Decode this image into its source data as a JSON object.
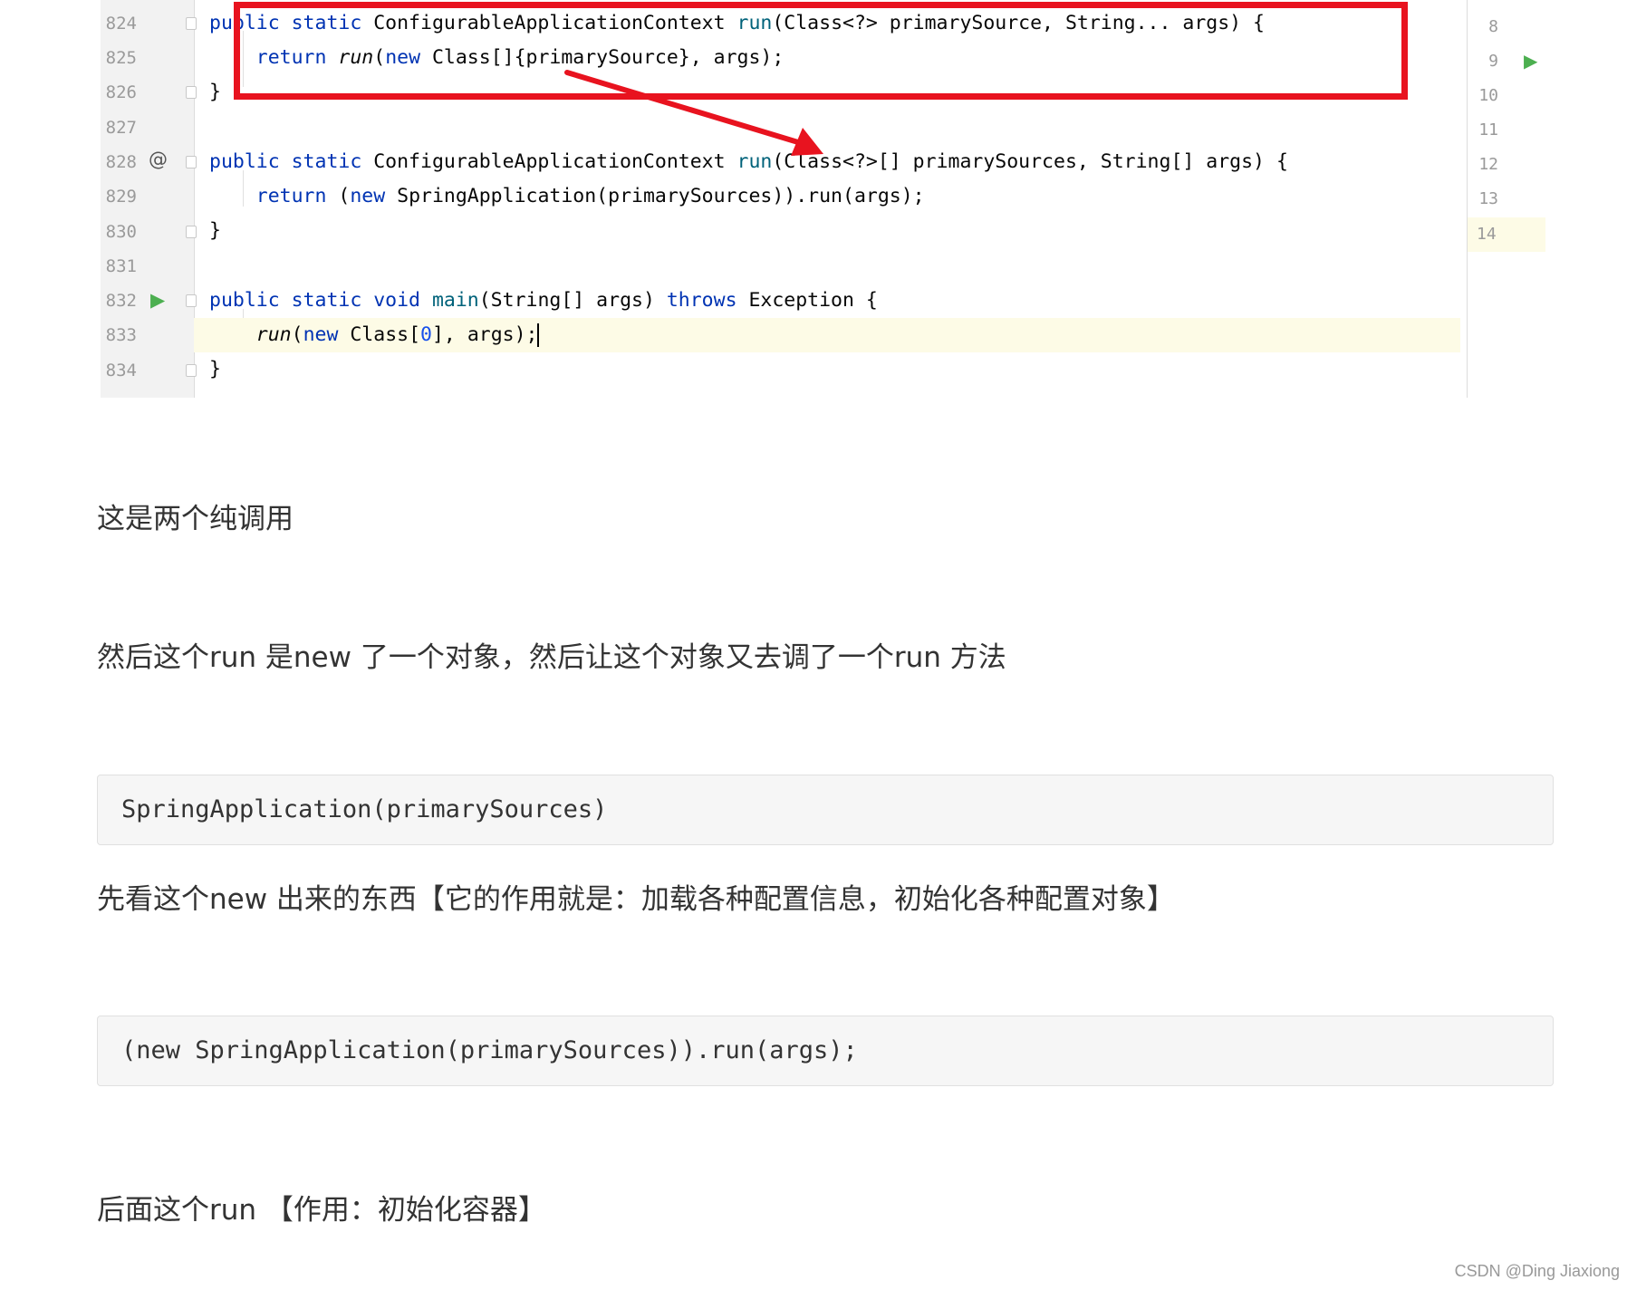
{
  "ide": {
    "line_numbers": [
      "824",
      "825",
      "826",
      "827",
      "828",
      "829",
      "830",
      "831",
      "832",
      "833",
      "834"
    ],
    "minimap_numbers": [
      "8",
      "9",
      "10",
      "11",
      "12",
      "13",
      "14"
    ],
    "annotation_symbol": "@",
    "code": {
      "l824_a": "public static ",
      "l824_b": "ConfigurableApplicationContext ",
      "l824_c": "run",
      "l824_d": "(Class<?> primarySource, String... args) {",
      "l825_a": "    return ",
      "l825_b": "run",
      "l825_c": "(",
      "l825_d": "new ",
      "l825_e": "Class[]{primarySource}, args);",
      "l826": "}",
      "l828_a": "public static ",
      "l828_b": "ConfigurableApplicationContext ",
      "l828_c": "run",
      "l828_d": "(Class<?>[] primarySources, String[] args) {",
      "l829_a": "    return ",
      "l829_b": "(",
      "l829_c": "new ",
      "l829_d": "SpringApplication(primarySources)).run(args);",
      "l830": "}",
      "l832_a": "public static void ",
      "l832_b": "main",
      "l832_c": "(String[] args) ",
      "l832_d": "throws ",
      "l832_e": "Exception {",
      "l833_a": "    ",
      "l833_b": "run",
      "l833_c": "(",
      "l833_d": "new ",
      "l833_e": "Class[",
      "l833_f": "0",
      "l833_g": "], args);",
      "l834": "}"
    },
    "colors": {
      "highlight_box": "#e8131f",
      "keyword": "#0033b3",
      "method": "#00627a",
      "current_line": "#fdfbe6"
    }
  },
  "article": {
    "p1": "这是两个纯调用",
    "p2": "然后这个run 是new 了一个对象，然后让这个对象又去调了一个run 方法",
    "code1": "SpringApplication(primarySources)",
    "p3": "先看这个new 出来的东西【它的作用就是：加载各种配置信息，初始化各种配置对象】",
    "code2": "(new SpringApplication(primarySources)).run(args);",
    "p4": "后面这个run 【作用：初始化容器】"
  },
  "watermark": "CSDN @Ding Jiaxiong"
}
